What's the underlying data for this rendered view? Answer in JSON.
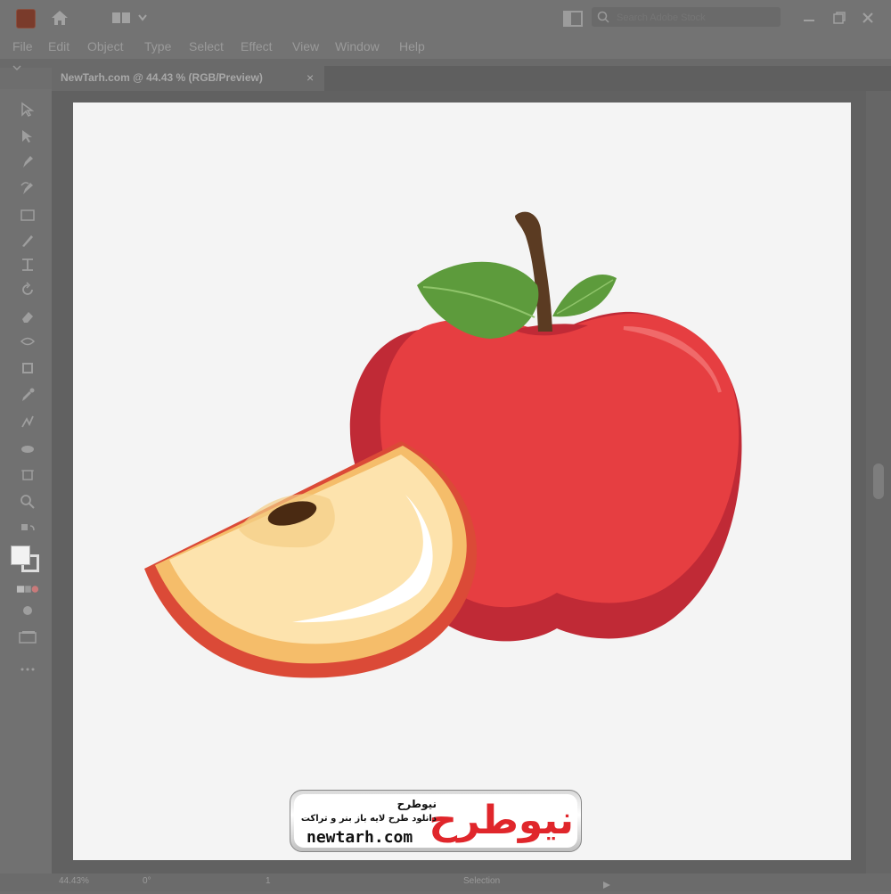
{
  "app": {
    "icon": "illustrator-app-icon",
    "search_placeholder": "Search Adobe Stock"
  },
  "menu": [
    "File",
    "Edit",
    "Object",
    "Type",
    "Select",
    "Effect",
    "View",
    "Window",
    "Help"
  ],
  "document_tab": {
    "title": "NewTarh.com @ 44.43 % (RGB/Preview)",
    "close": "×"
  },
  "status": {
    "zoom": "44.43%",
    "rotation": "0°",
    "artboard": "1",
    "tool": "Selection"
  },
  "toolbar_tools": [
    "selection-tool",
    "direct-selection-tool",
    "pen-tool",
    "curvature-tool",
    "rectangle-tool",
    "paintbrush-tool",
    "shaper-tool",
    "rotate-tool",
    "eraser-tool",
    "width-tool",
    "free-transform-tool",
    "shape-builder-tool",
    "eyedropper-tool",
    "blend-tool",
    "artboard-tool",
    "hand-tool",
    "zoom-tool"
  ],
  "watermark": {
    "brand_fa": "نیوطرح",
    "tagline_fa": "دانلود طرح لایه باز بنر و تراکت",
    "url": "newtarh.com",
    "logo_word_fa": "نیوطرح"
  },
  "colors": {
    "apple_red": "#e63e41",
    "apple_dark": "#c02a36",
    "apple_highlight": "#f06a6a",
    "slice_flesh": "#fde3ad",
    "slice_rim": "#f5bd6a",
    "leaf_green": "#5d9b3c",
    "stem_brown": "#5b3b22",
    "logo_red": "#e0262b",
    "logo_blue": "#1b4f9c"
  }
}
